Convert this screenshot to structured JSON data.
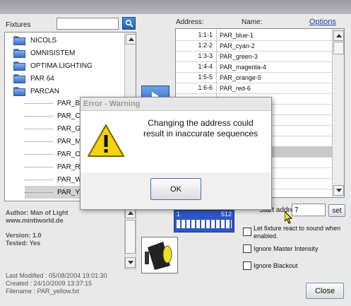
{
  "window": {
    "titlebar": ""
  },
  "fixtures": {
    "label": "Fixtures",
    "search_value": "",
    "folders": [
      "NICOLS",
      "OMNISISTEM",
      "OPTIMA LIGHTING",
      "PAR 64",
      "PARCAN"
    ],
    "sub_items": [
      "PAR_BL",
      "PAR_CY",
      "PAR_GR",
      "PAR_MA",
      "PAR_OR",
      "PAR_RE",
      "PAR_WH",
      "PAR_YE"
    ]
  },
  "info": {
    "author": "Author: Man of Light",
    "website": "www.mintiworld.de",
    "version": "Version: 1.0",
    "tested": "Tested: Yes",
    "modified": "Last Modified : 05/08/2004 19:01:30",
    "created": "Created : 24/10/2009 13:37:15",
    "filename": "Filename : PAR_yellow.fxt"
  },
  "address_panel": {
    "address_label": "Address:",
    "name_label": "Name:",
    "options_link": "Options",
    "rows": [
      {
        "address": "1:1-1",
        "name": "PAR_blue-1"
      },
      {
        "address": "1:2-2",
        "name": "PAR_cyan-2"
      },
      {
        "address": "1:3-3",
        "name": "PAR_green-3"
      },
      {
        "address": "1:4-4",
        "name": "PAR_magenta-4"
      },
      {
        "address": "1:5-5",
        "name": "PAR_orange-5"
      },
      {
        "address": "1:6-6",
        "name": "PAR_red-6"
      }
    ]
  },
  "start_address": {
    "label": "Start address :",
    "value": "7",
    "set_label": "set"
  },
  "dmx_bar": {
    "start": "1",
    "end": "512"
  },
  "options": {
    "sound": "Let fixture react to sound when enabled.",
    "ignore_master": "Ignore Master Intensity",
    "ignore_blackout": "Ignore Blackout"
  },
  "close_label": "Close",
  "dialog": {
    "title": "Error - Warning",
    "message": "Changing the address could result in inaccurate sequences",
    "ok_label": "OK"
  }
}
